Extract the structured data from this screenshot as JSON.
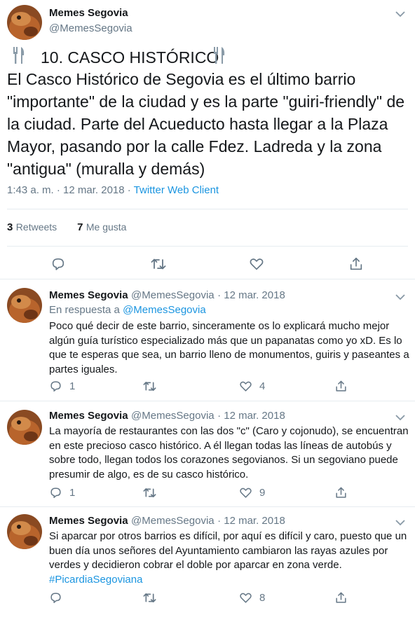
{
  "colors": {
    "link": "#1b95e0",
    "muted": "#657786",
    "divider": "#e6ecf0"
  },
  "main_tweet": {
    "author_name": "Memes Segovia",
    "author_handle": "@MemesSegovia",
    "avatar_icon": "avatar-icon",
    "title_icon_left": "fork-knife-icon",
    "title_icon_right": "fork-knife-icon",
    "title": "10. CASCO HISTÓRICO",
    "text": "El Casco Histórico de Segovia es el último barrio \"importante\" de la ciudad y es la parte \"guiri-friendly\" de la ciudad. Parte del Acueducto hasta llegar a la Plaza Mayor, pasando por la calle Fdez. Ladreda y la zona \"antigua\" (muralla y demás)",
    "time": "1:43 a. m. · 12 mar. 2018 · ",
    "client": "Twitter Web Client",
    "retweets_count": "3",
    "retweets_label": "Retweets",
    "likes_count": "7",
    "likes_label": "Me gusta"
  },
  "replies": [
    {
      "author_name": "Memes Segovia",
      "author_handle": "@MemesSegovia",
      "date": "· 12 mar. 2018",
      "reply_prefix": "En respuesta a ",
      "reply_to": "@MemesSegovia",
      "text": "Poco qué decir de este barrio, sinceramente os lo explicará mucho mejor algún guía turístico especializado más que un papanatas como yo xD. Es lo que te esperas que sea, un barrio lleno de monumentos, guiris y paseantes a partes iguales.",
      "reply_count": "1",
      "retweet_count": "",
      "like_count": "4"
    },
    {
      "author_name": "Memes Segovia",
      "author_handle": "@MemesSegovia",
      "date": "· 12 mar. 2018",
      "text": "La mayoría de restaurantes con las dos \"c\" (Caro y cojonudo), se encuentran en este precioso casco histórico. A él llegan todas las líneas de autobús y sobre todo, llegan todos los corazones segovianos. Si un segoviano puede presumir de algo, es de su casco histórico.",
      "reply_count": "1",
      "retweet_count": "",
      "like_count": "9"
    },
    {
      "author_name": "Memes Segovia",
      "author_handle": "@MemesSegovia",
      "date": "· 12 mar. 2018",
      "text": "Si aparcar por otros barrios es difícil, por aquí es difícil y caro, puesto que un buen día unos señores del Ayuntamiento cambiaron las rayas azules por verdes y decidieron cobrar el doble por aparcar en zona verde. ",
      "hashtag": "#PicardiaSegoviana",
      "reply_count": "",
      "retweet_count": "",
      "like_count": "8"
    }
  ]
}
